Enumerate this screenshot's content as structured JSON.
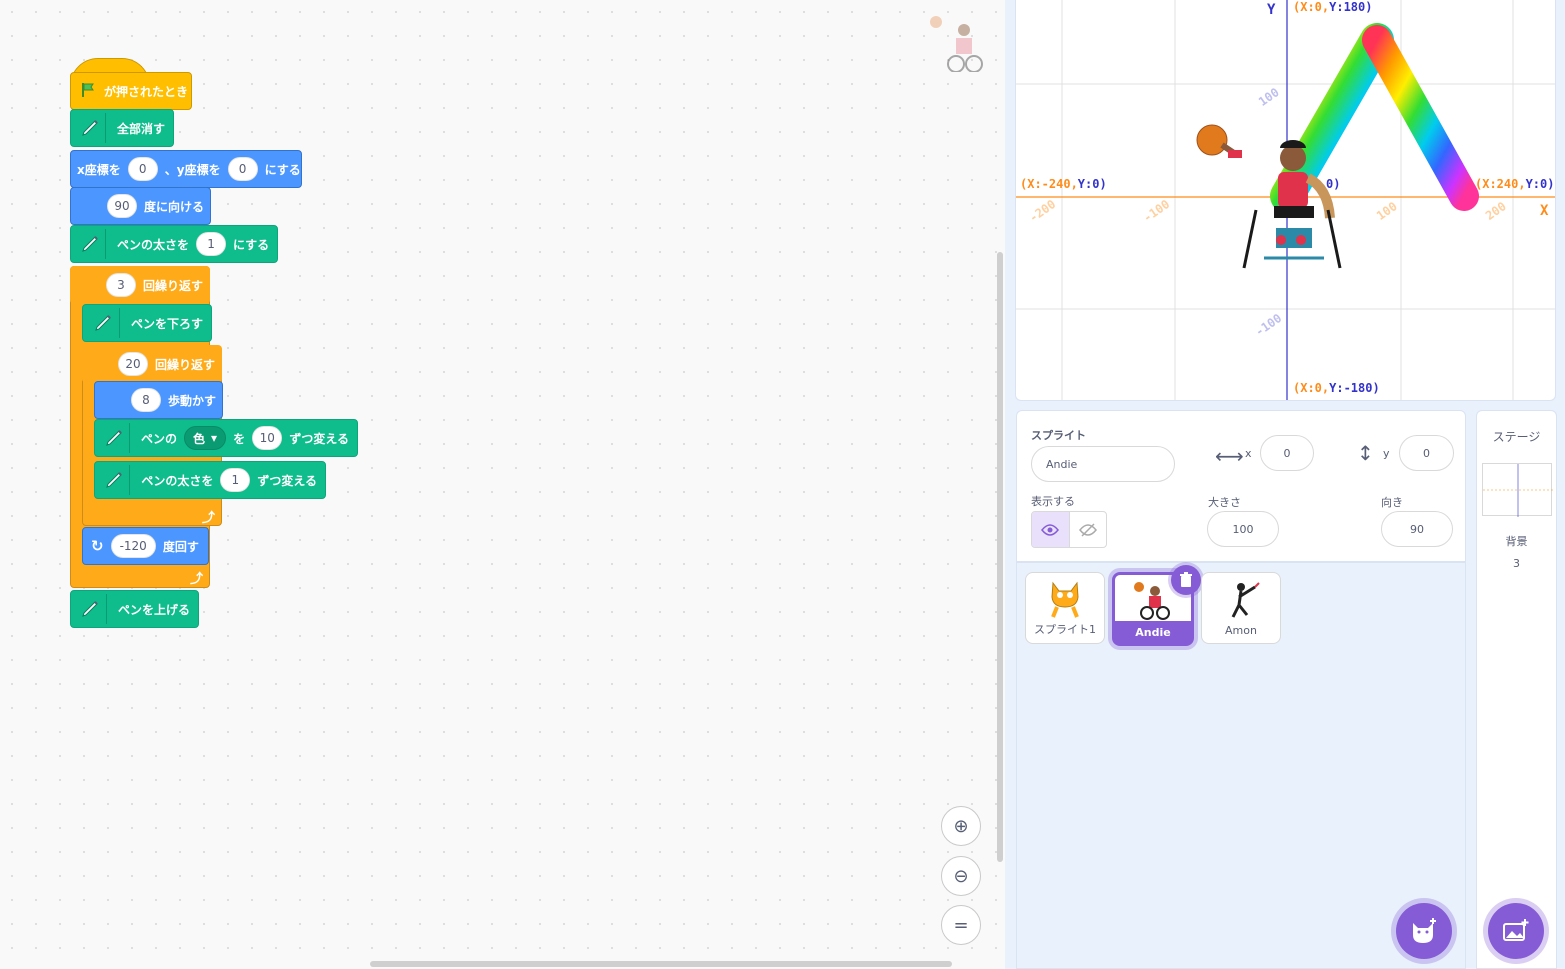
{
  "blocks": {
    "hat": "が押されたとき",
    "clear": "全部消す",
    "goto": {
      "pre": "x座標を",
      "x": "0",
      "mid": "、y座標を",
      "y": "0",
      "post": "にする"
    },
    "point": {
      "deg": "90",
      "label": "度に向ける"
    },
    "pen_size": {
      "label": "ペンの太さを",
      "val": "1",
      "post": "にする"
    },
    "repeat_outer": {
      "count": "3",
      "label": "回繰り返す"
    },
    "pen_down": "ペンを下ろす",
    "repeat_inner": {
      "count": "20",
      "label": "回繰り返す"
    },
    "move": {
      "steps": "8",
      "label": "歩動かす"
    },
    "change_color": {
      "pre": "ペンの",
      "param": "色",
      "mid": "を",
      "val": "10",
      "post": "ずつ変える"
    },
    "change_size": {
      "pre": "ペンの太さを",
      "val": "1",
      "post": "ずつ変える"
    },
    "turn": {
      "deg": "-120",
      "label": "度回す"
    },
    "pen_up": "ペンを上げる"
  },
  "stage": {
    "y_axis": "Y",
    "x_axis": "X",
    "top": {
      "k": "(X:0,",
      "v": "Y:180)"
    },
    "bottom": {
      "k": "(X:0,",
      "v": "Y:-180)"
    },
    "left": {
      "k": "(X:-240,",
      "v": "Y:0)"
    },
    "right": {
      "k": "(X:240,",
      "v": "Y:0)"
    },
    "center": "0)",
    "ticks": {
      "x_m200": "-200",
      "x_m100": "-100",
      "x_100": "100",
      "x_200": "200",
      "y_100": "100",
      "y_m100": "-100"
    }
  },
  "sprite_info": {
    "sprite_label": "スプライト",
    "name": "Andie",
    "x_label": "x",
    "x": "0",
    "y_label": "y",
    "y": "0",
    "show_label": "表示する",
    "size_label": "大きさ",
    "size": "100",
    "direction_label": "向き",
    "direction": "90"
  },
  "sprites": [
    {
      "name": "スプライト1"
    },
    {
      "name": "Andie"
    },
    {
      "name": "Amon"
    }
  ],
  "stage_panel": {
    "title": "ステージ",
    "backdrop_label": "背景",
    "backdrop_count": "3"
  },
  "colors": {
    "pen": "#0fbd8c",
    "motion": "#4c97ff",
    "control": "#ffab19",
    "event": "#ffbf00",
    "accent": "#855cd6"
  }
}
